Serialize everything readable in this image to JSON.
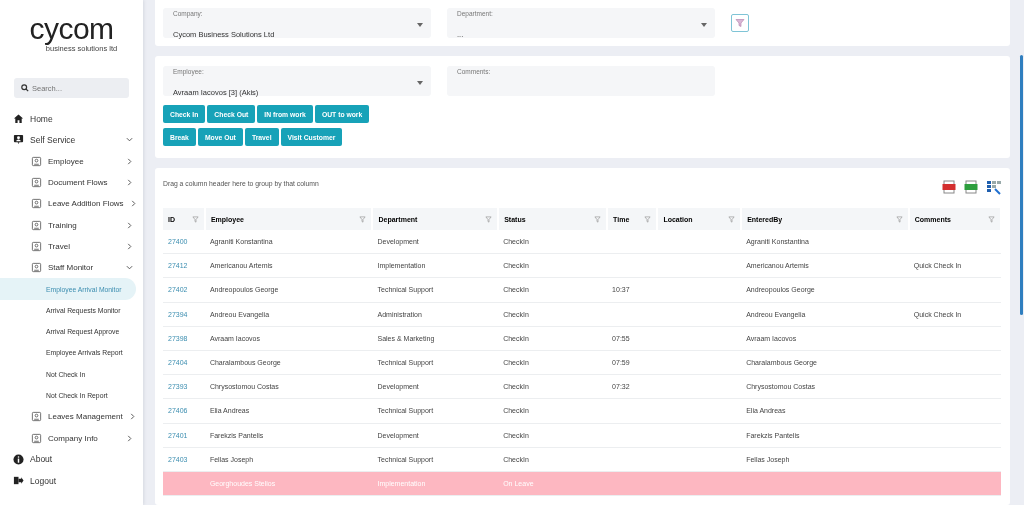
{
  "logo": {
    "name": "cycom",
    "tagline": "business solutions ltd"
  },
  "search": {
    "placeholder": "Search..."
  },
  "nav": [
    {
      "label": "Home",
      "kind": "home"
    },
    {
      "label": "Self Service",
      "kind": "person",
      "expanded": true,
      "children": [
        {
          "label": "Employee",
          "kind": "page",
          "expanded": false
        },
        {
          "label": "Document Flows",
          "kind": "page",
          "expanded": false
        },
        {
          "label": "Leave Addition Flows",
          "kind": "page",
          "expanded": false
        },
        {
          "label": "Training",
          "kind": "page",
          "expanded": false
        },
        {
          "label": "Travel",
          "kind": "page",
          "expanded": false
        },
        {
          "label": "Staff Monitor",
          "kind": "page",
          "expanded": true,
          "children": [
            {
              "label": "Employee Arrival Monitor",
              "selected": true
            },
            {
              "label": "Arrival Requests Monitor",
              "selected": false
            },
            {
              "label": "Arrival Request Approve",
              "selected": false
            },
            {
              "label": "Employee Arrivals Report",
              "selected": false
            },
            {
              "label": "Not Check In",
              "selected": false
            },
            {
              "label": "Not Check In Report",
              "selected": false
            }
          ]
        },
        {
          "label": "Leaves Management",
          "kind": "page",
          "expanded": false
        },
        {
          "label": "Company Info",
          "kind": "page",
          "expanded": false
        }
      ]
    },
    {
      "label": "About",
      "kind": "info"
    },
    {
      "label": "Logout",
      "kind": "logout"
    }
  ],
  "filters": {
    "company": {
      "label": "Company:",
      "value": "Cycom Business Solutions Ltd"
    },
    "department": {
      "label": "Department:",
      "value": "..."
    }
  },
  "entry": {
    "employee": {
      "label": "Employee:",
      "value": "Avraam Iacovos [3] (Akis)"
    },
    "comments": {
      "label": "Comments:"
    },
    "buttons": [
      [
        "Check In",
        "Check Out",
        "IN from work",
        "OUT to work"
      ],
      [
        "Break",
        "Move Out",
        "Travel",
        "Visit Customer"
      ]
    ]
  },
  "table": {
    "group_hint": "Drag a column header here to group by that column",
    "columns": [
      "ID",
      "Employee",
      "Department",
      "Status",
      "Time",
      "Location",
      "EnteredBy",
      "Comments"
    ],
    "rows": [
      {
        "kind": "checkin",
        "cells": [
          "27400",
          "Agraniti Konstantina",
          "Development",
          "CheckIn",
          "",
          "",
          "Agraniti Konstantina",
          ""
        ]
      },
      {
        "kind": "checkin",
        "cells": [
          "27412",
          "Americanou Artemis",
          "Implementation",
          "CheckIn",
          "",
          "",
          "Americanou Artemis",
          "Quick Check In"
        ]
      },
      {
        "kind": "checkin",
        "cells": [
          "27402",
          "Andreopoulos George",
          "Technical Support",
          "CheckIn",
          "10:37",
          "",
          "Andreopoulos George",
          ""
        ]
      },
      {
        "kind": "checkin",
        "cells": [
          "27394",
          "Andreou Evangelia",
          "Administration",
          "CheckIn",
          "",
          "",
          "Andreou Evangelia",
          "Quick Check In"
        ]
      },
      {
        "kind": "checkin",
        "cells": [
          "27398",
          "Avraam Iacovos",
          "Sales & Marketing",
          "CheckIn",
          "07:55",
          "",
          "Avraam Iacovos",
          ""
        ]
      },
      {
        "kind": "checkin",
        "cells": [
          "27404",
          "Charalambous George",
          "Technical Support",
          "CheckIn",
          "07:59",
          "",
          "Charalambous George",
          ""
        ]
      },
      {
        "kind": "checkin",
        "cells": [
          "27393",
          "Chrysostomou Costas",
          "Development",
          "CheckIn",
          "07:32",
          "",
          "Chrysostomou Costas",
          ""
        ]
      },
      {
        "kind": "checkin",
        "cells": [
          "27406",
          "Elia Andreas",
          "Technical Support",
          "CheckIn",
          "",
          "",
          "Elia Andreas",
          ""
        ]
      },
      {
        "kind": "checkin",
        "cells": [
          "27401",
          "Farekzis Pantelis",
          "Development",
          "CheckIn",
          "",
          "",
          "Farekzis Pantelis",
          ""
        ]
      },
      {
        "kind": "checkin",
        "cells": [
          "27403",
          "Fellas Joseph",
          "Technical Support",
          "CheckIn",
          "",
          "",
          "Fellas Joseph",
          ""
        ]
      },
      {
        "kind": "leave",
        "cells": [
          "",
          "Georghoudes Stelios",
          "Implementation",
          "On Leave",
          "",
          "",
          "",
          ""
        ]
      }
    ]
  }
}
